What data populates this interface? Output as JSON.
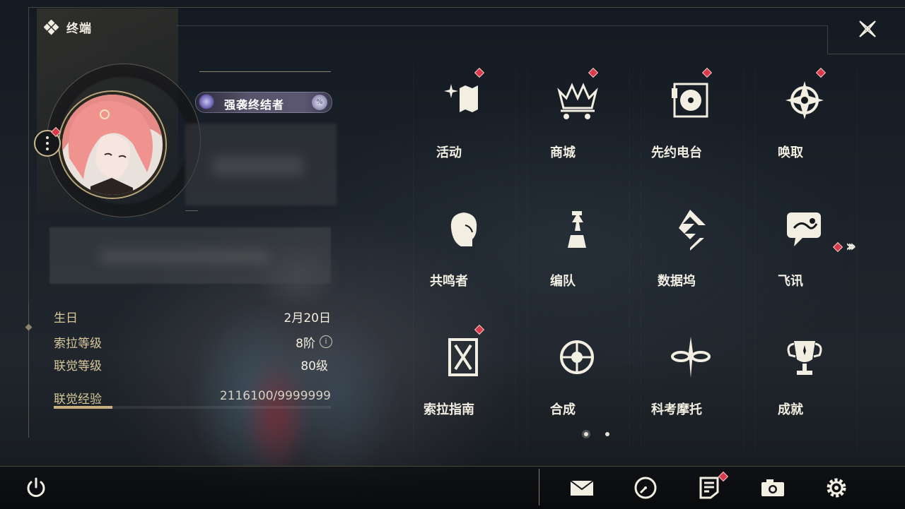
{
  "header": {
    "title": "终端",
    "logo_icon": "diamond-cluster-icon",
    "close_icon": "close-icon"
  },
  "profile": {
    "avatar_icon": "pink-hair-character-avatar",
    "title_badge": "强袭终结者",
    "stats": [
      {
        "label": "生日",
        "value": "2月20日"
      },
      {
        "label": "索拉等级",
        "value": "8阶"
      },
      {
        "label": "联觉等级",
        "value": "80级"
      }
    ],
    "info_glyph": "i",
    "exp": {
      "label": "联觉经验",
      "value": "2116100/9999999",
      "progress": 0.2116
    }
  },
  "menu": [
    {
      "label": "活动",
      "icon": "sparkle-flag-icon",
      "badge": true
    },
    {
      "label": "商城",
      "icon": "crown-cart-icon",
      "badge": true
    },
    {
      "label": "先约电台",
      "icon": "radio-record-icon",
      "badge": true
    },
    {
      "label": "唤取",
      "icon": "compass-star-icon",
      "badge": true
    },
    {
      "label": "共鸣者",
      "icon": "character-head-icon",
      "badge": false
    },
    {
      "label": "编队",
      "icon": "chess-piece-icon",
      "badge": false
    },
    {
      "label": "数据坞",
      "icon": "data-dock-icon",
      "badge": false
    },
    {
      "label": "飞讯",
      "icon": "chat-bubble-icon",
      "badge": false
    },
    {
      "label": "索拉指南",
      "icon": "guide-book-icon",
      "badge": true
    },
    {
      "label": "合成",
      "icon": "synthesis-circle-icon",
      "badge": false
    },
    {
      "label": "科考摩托",
      "icon": "motorcycle-icon",
      "badge": false
    },
    {
      "label": "成就",
      "icon": "trophy-icon",
      "badge": false
    }
  ],
  "pagination": {
    "current": 1,
    "total": 2
  },
  "bottom_bar": [
    {
      "name": "mail",
      "icon": "envelope-icon",
      "badge": false
    },
    {
      "name": "timer",
      "icon": "clock-icon",
      "badge": false
    },
    {
      "name": "notes",
      "icon": "notice-icon",
      "badge": true
    },
    {
      "name": "camera",
      "icon": "camera-icon",
      "badge": false
    },
    {
      "name": "settings",
      "icon": "gear-icon",
      "badge": false
    }
  ],
  "colors": {
    "accent": "#d9c79c",
    "badge": "#d8394b",
    "text": "#f2eee2",
    "exp_bar": "#c9b07e"
  }
}
